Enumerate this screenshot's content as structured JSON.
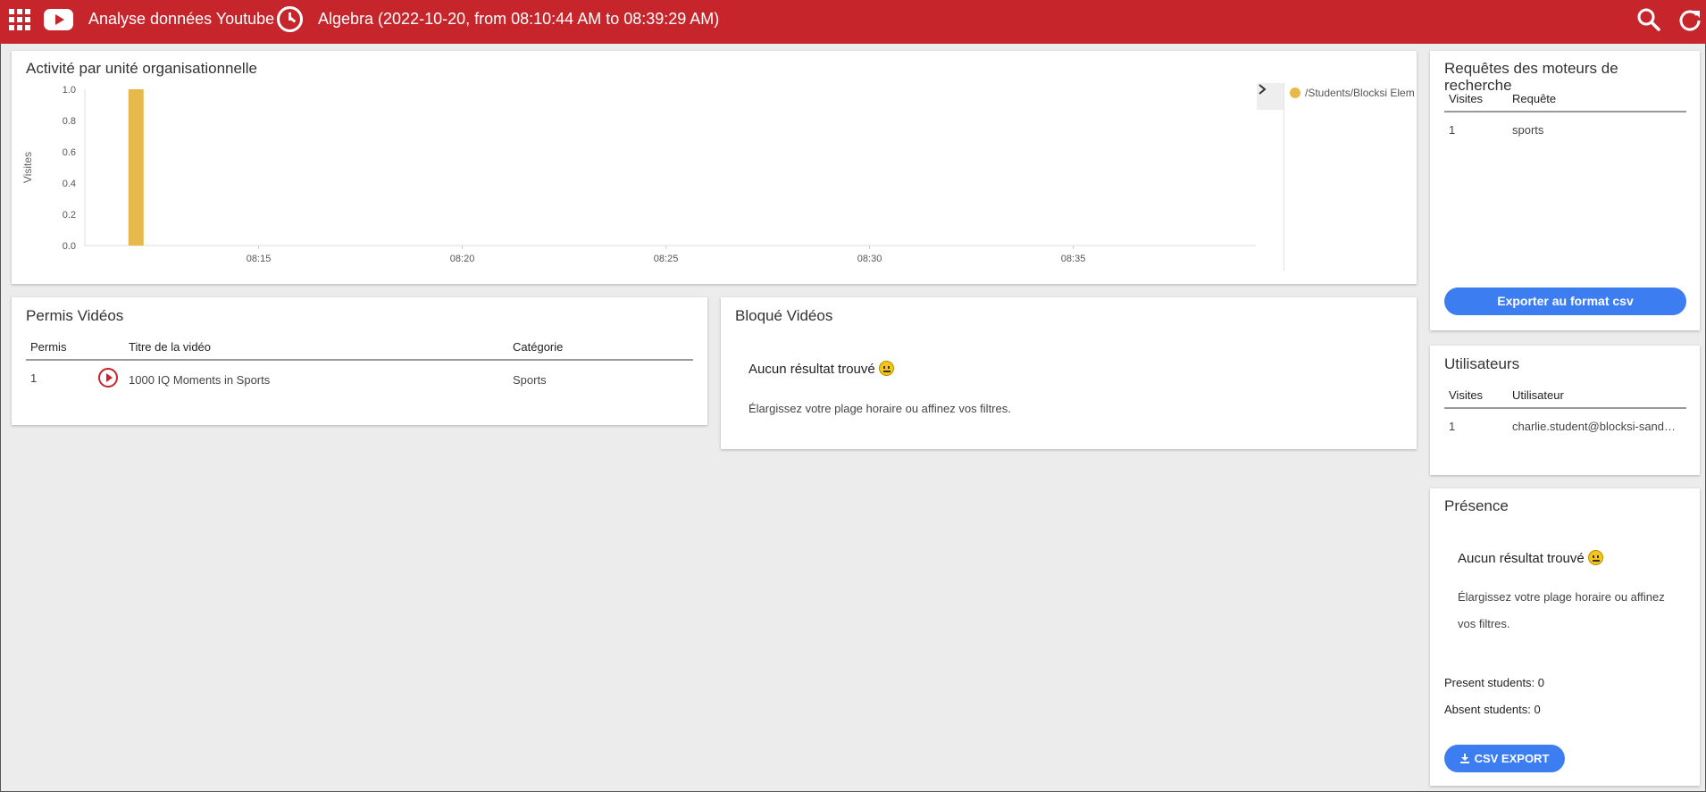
{
  "header": {
    "app_title": "Analyse données Youtube",
    "session": "Algebra (2022-10-20, from 08:10:44 AM to 08:39:29 AM)",
    "icons": [
      "apps-grid-icon",
      "youtube-icon",
      "clock-icon",
      "search-icon",
      "refresh-icon"
    ]
  },
  "activity": {
    "title": "Activité par unité organisationnelle",
    "legend_entry": "/Students/Blocksi Elem",
    "legend_toggle": "›"
  },
  "chart_data": {
    "type": "bar",
    "ylabel": "Visites",
    "xlabel": "",
    "ylim": [
      0,
      1.0
    ],
    "yticks": [
      "0.0",
      "0.2",
      "0.4",
      "0.6",
      "0.8",
      "1.0"
    ],
    "x_time_range": [
      "08:10:44",
      "08:39:29"
    ],
    "xticks": [
      "08:15:00",
      "08:20:00",
      "08:25:00",
      "08:30:00",
      "08:35:00"
    ],
    "series": [
      {
        "name": "/Students/Blocksi Elem",
        "color": "#e6b94a",
        "points": [
          {
            "x": "08:12:00",
            "y": 1
          }
        ]
      }
    ]
  },
  "allowed": {
    "title": "Permis Vidéos",
    "columns": [
      "Permis",
      "Titre de la vidéo",
      "Catégorie"
    ],
    "rows": [
      {
        "count": "1",
        "title": "1000 IQ Moments in Sports",
        "category": "Sports"
      }
    ]
  },
  "blocked": {
    "title": "Bloqué Vidéos",
    "empty_title": "Aucun résultat trouvé",
    "empty_msg": "Élargissez votre plage horaire ou affinez vos filtres."
  },
  "queries": {
    "title": "Requêtes des moteurs de recherche",
    "columns": [
      "Visites",
      "Requête"
    ],
    "rows": [
      {
        "visits": "1",
        "query": "sports"
      }
    ],
    "export_label": "Exporter au format csv"
  },
  "users": {
    "title": "Utilisateurs",
    "columns": [
      "Visites",
      "Utilisateur"
    ],
    "rows": [
      {
        "visits": "1",
        "user": "charlie.student@blocksi-sandbox.com"
      }
    ]
  },
  "presence": {
    "title": "Présence",
    "empty_title": "Aucun résultat trouvé",
    "empty_msg": "Élargissez votre plage horaire ou affinez vos filtres.",
    "present": "Present students: 0",
    "absent": "Absent students: 0",
    "export_label": "CSV EXPORT"
  }
}
